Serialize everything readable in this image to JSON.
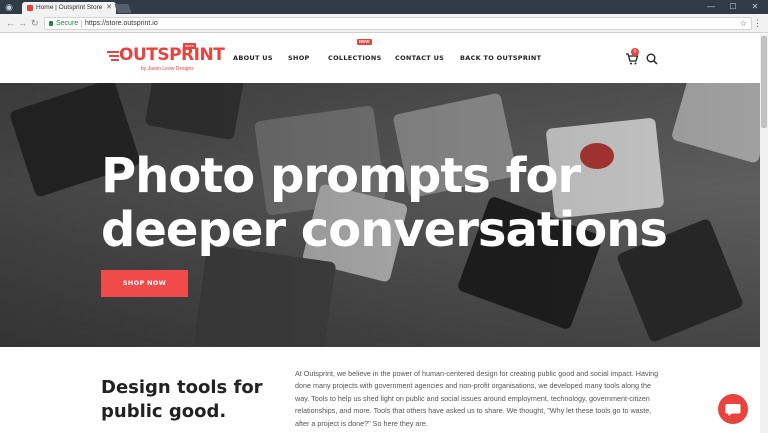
{
  "browser": {
    "tab_title": "Home | Outsprint Store",
    "tab_close": "✕",
    "secure_label": "Secure",
    "url": "https://store.outsprint.io",
    "window_controls": [
      "—",
      "☐",
      "✕"
    ]
  },
  "header": {
    "logo": {
      "wordmark": "OUTSPRINT",
      "tagline": "by Jason Leow Designs",
      "badge": "store"
    },
    "nav": [
      {
        "label": "ABOUT US"
      },
      {
        "label": "SHOP"
      },
      {
        "label": "COLLECTIONS",
        "badge": "NEW"
      },
      {
        "label": "CONTACT US"
      },
      {
        "label": "BACK TO OUTSPRINT"
      }
    ],
    "cart_count": "0",
    "icons": {
      "cart": "cart-icon",
      "search": "search-icon"
    }
  },
  "hero": {
    "title_line1": "Photo prompts for",
    "title_line2": "deeper conversations",
    "cta_label": "SHOP NOW"
  },
  "content": {
    "heading_line1": "Design tools for",
    "heading_line2": "public good.",
    "paragraph": "At Outsprint, we believe in the power of human-centered design for creating public good and social impact. Having done many projects with government agencies and non-profit organisations, we developed many tools along the way. Tools to help us shed light on public and social issues around employment, technology, government-citizen relationships, and more. Tools that others have asked us to share. We thought, \"Why let these tools go to waste, after a project is done?\" So here they are."
  },
  "colors": {
    "brand": "#e8433f",
    "cta": "#f04a4a",
    "text": "#222222"
  }
}
